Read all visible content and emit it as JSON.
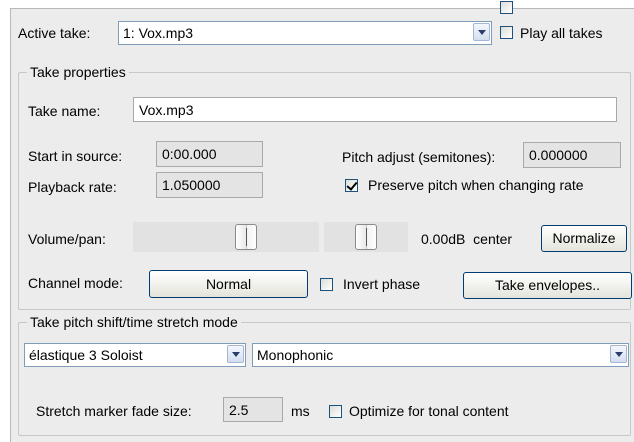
{
  "header": {
    "active_take_label": "Active take:",
    "active_take_value": "1: Vox.mp3",
    "play_all_takes_label": "Play all takes",
    "play_all_takes_checked": false
  },
  "take_properties": {
    "legend": "Take properties",
    "take_name_label": "Take name:",
    "take_name_value": "Vox.mp3",
    "start_in_source_label": "Start in source:",
    "start_in_source_value": "0:00.000",
    "pitch_adjust_label": "Pitch adjust (semitones):",
    "pitch_adjust_value": "0.000000",
    "playback_rate_label": "Playback rate:",
    "playback_rate_value": "1.050000",
    "preserve_pitch_label": "Preserve pitch when changing rate",
    "preserve_pitch_checked": true,
    "volume_pan_label": "Volume/pan:",
    "volume_level": 0.62,
    "pan_level": 0.5,
    "volume_readout": "0.00dB  center",
    "normalize_label": "Normalize",
    "channel_mode_label": "Channel mode:",
    "channel_mode_value": "Normal",
    "invert_phase_label": "Invert phase",
    "invert_phase_checked": false,
    "take_envelopes_label": "Take envelopes.."
  },
  "pitch_shift": {
    "legend": "Take pitch shift/time stretch mode",
    "algorithm_value": "élastique 3 Soloist",
    "mode_value": "Monophonic",
    "fade_size_label": "Stretch marker fade size:",
    "fade_size_value": "2.5",
    "fade_size_unit": "ms",
    "optimize_label": "Optimize for tonal content",
    "optimize_checked": false
  }
}
